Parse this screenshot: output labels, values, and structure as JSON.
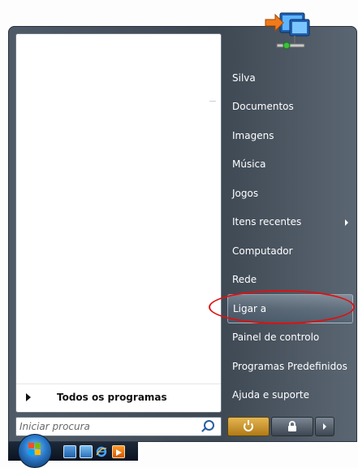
{
  "start_menu": {
    "all_programs_label": "Todos os programas",
    "search_placeholder": "Iniciar procura",
    "right_items": [
      {
        "label": "Silva",
        "has_submenu": false
      },
      {
        "label": "Documentos",
        "has_submenu": false
      },
      {
        "label": "Imagens",
        "has_submenu": false
      },
      {
        "label": "Música",
        "has_submenu": false
      },
      {
        "label": "Jogos",
        "has_submenu": false
      },
      {
        "label": "Itens recentes",
        "has_submenu": true
      },
      {
        "label": "Computador",
        "has_submenu": false
      },
      {
        "label": "Rede",
        "has_submenu": false
      },
      {
        "label": "Ligar a",
        "has_submenu": false,
        "highlighted": true
      },
      {
        "label": "Painel de controlo",
        "has_submenu": false
      },
      {
        "label": "Programas Predefinidos",
        "has_submenu": false
      },
      {
        "label": "Ajuda e suporte",
        "has_submenu": false
      }
    ],
    "icons": {
      "user_picture": "network-icon",
      "power": "power-icon",
      "lock": "lock-icon",
      "more": "chevron-right-icon",
      "search": "search-icon"
    }
  },
  "taskbar": {
    "start_orb": "windows-orb-icon",
    "quicklaunch": [
      "show-desktop-icon",
      "switch-windows-icon",
      "internet-explorer-icon",
      "media-player-icon"
    ]
  },
  "colors": {
    "highlight_ellipse": "#dd1111",
    "power_button": "#d29a2f",
    "menu_glass": "#2b3a4a"
  }
}
